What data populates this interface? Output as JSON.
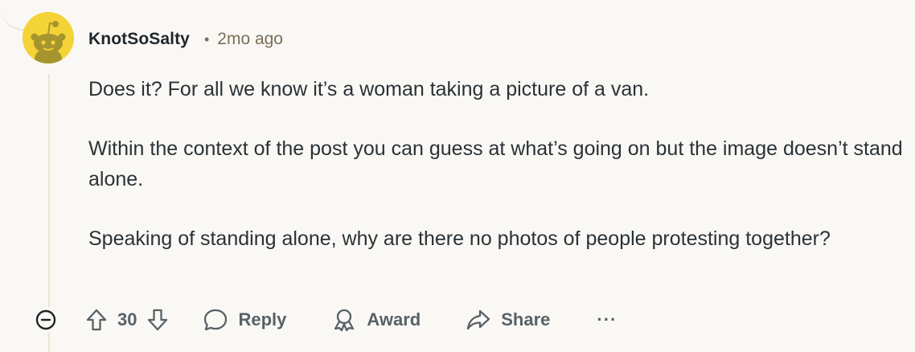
{
  "comment": {
    "author": "KnotSoSalty",
    "separator": "•",
    "timestamp": "2mo ago",
    "paragraphs": [
      "Does it? For all we know it’s a woman taking a picture of a van.",
      "Within the context of the post you can guess at what’s going on but the image doesn’t stand alone.",
      "Speaking of standing alone, why are there no photos of people protesting together?"
    ]
  },
  "actions": {
    "collapse_icon": "minus-circle-icon",
    "upvote_icon": "arrow-up-icon",
    "vote_count": "30",
    "downvote_icon": "arrow-down-icon",
    "reply_label": "Reply",
    "reply_icon": "speech-bubble-icon",
    "award_label": "Award",
    "award_icon": "award-ribbon-icon",
    "share_label": "Share",
    "share_icon": "share-arrow-icon",
    "more_label": "···"
  },
  "colors": {
    "background": "#FAF8F5",
    "avatar_bg": "#F4D336",
    "avatar_figure": "#A6942E",
    "text": "#2A3236",
    "meta": "#7A6E5A",
    "action": "#576166",
    "thread_line": "#EDE3D2"
  }
}
